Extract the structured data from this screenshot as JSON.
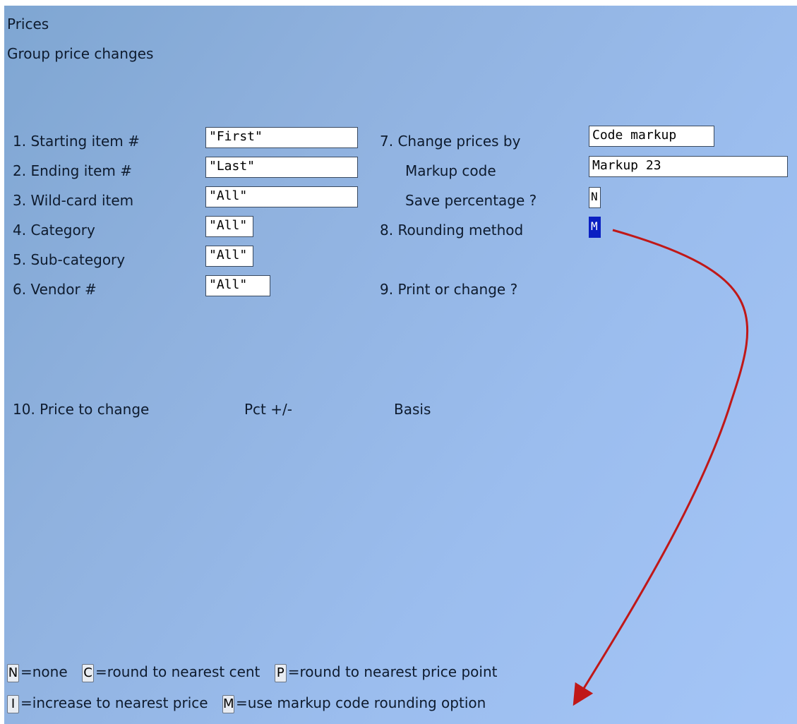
{
  "header": {
    "title": "Prices",
    "subtitle": "Group price changes"
  },
  "left_fields": [
    {
      "label": "1. Starting item #",
      "value": "\"First\""
    },
    {
      "label": "2. Ending item #",
      "value": "\"Last\""
    },
    {
      "label": "3. Wild-card item",
      "value": "\"All\""
    },
    {
      "label": "4. Category",
      "value": "\"All\""
    },
    {
      "label": "5. Sub-category",
      "value": "\"All\""
    },
    {
      "label": "6. Vendor #",
      "value": "\"All\""
    }
  ],
  "right_fields": {
    "change_prices_by": {
      "label": "7. Change prices by",
      "value": "Code markup"
    },
    "markup_code": {
      "label": "Markup code",
      "value": "Markup 23"
    },
    "save_percentage": {
      "label": "Save percentage ?",
      "value": "N"
    },
    "rounding_method": {
      "label": "8. Rounding method",
      "value": "M"
    },
    "print_or_change": {
      "label": "9. Print or change ?"
    }
  },
  "price_table_header": {
    "price_to_change": "10. Price to change",
    "pct": "Pct +/-",
    "basis": "Basis"
  },
  "legend": {
    "line1": [
      {
        "key": "N",
        "text": "=none"
      },
      {
        "key": "C",
        "text": "=round to nearest cent"
      },
      {
        "key": "P",
        "text": "=round to nearest price point"
      }
    ],
    "line2": [
      {
        "key": "I",
        "text": "=increase to nearest price"
      },
      {
        "key": "M",
        "text": "=use markup code rounding option"
      }
    ]
  },
  "colors": {
    "selected_field_bg": "#0a1fc2",
    "annotation_arrow": "#c01818"
  }
}
